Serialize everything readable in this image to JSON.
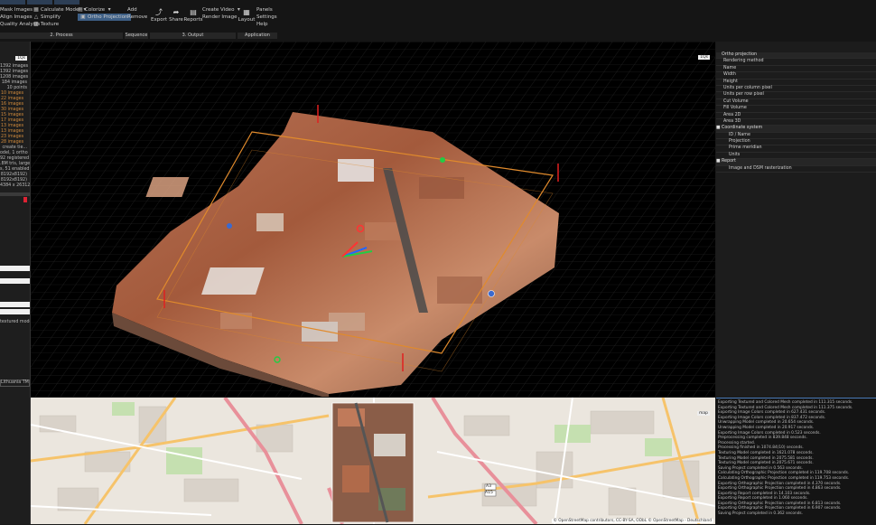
{
  "ribbon": {
    "tabs": [
      "",
      "",
      ""
    ],
    "process": {
      "label": "2. Process",
      "col1": [
        "Mask Images",
        "Align Images",
        "Quality Analysis"
      ],
      "col2": [
        "Calculate Model",
        "Simplify",
        "Texture"
      ],
      "col3": [
        "Colorize",
        "Ortho Projection"
      ]
    },
    "sequence": {
      "label": "Sequence",
      "items": [
        "Add",
        "Remove"
      ]
    },
    "output": {
      "label": "3. Output",
      "big": [
        "Export",
        "Share",
        "Reports"
      ],
      "items": [
        "Create Video",
        "Render Image"
      ]
    },
    "application": {
      "label": "Application",
      "big": "Layout",
      "items": [
        "Panels",
        "Settings",
        "Help"
      ]
    }
  },
  "left_panel": {
    "badge": "1Qs",
    "stats": [
      "1392 images",
      "1392 images",
      "1208 images",
      "184 images",
      "10 points"
    ],
    "groups": [
      "10 images",
      "22 images",
      "16 images",
      "30 images",
      "15 images",
      "17 images",
      "13 images",
      "13 images",
      "23 images",
      "28 images"
    ],
    "info": [
      "create tie...",
      "odel, 1 ortho",
      "92 registered",
      ".8M tris, large",
      "s, 51 enabled",
      "8192x8192)",
      "8192x8192)",
      "4384 x 26312"
    ],
    "lower": [
      "textured mode",
      "Lithuania TM"
    ]
  },
  "viewport": {
    "badge": "1Qs"
  },
  "properties": {
    "title": "Ortho projection",
    "rows": [
      "Rendering method",
      "Name",
      "Width",
      "Height",
      "Units per column pixel",
      "Units per row pixel",
      "Cut Volume",
      "Fill Volume",
      "Area 2D",
      "Area 3D"
    ],
    "coord_title": "Coordinate system",
    "coord_rows": [
      "ID / Name",
      "Projection",
      "Prime meridian",
      "Units"
    ],
    "report_title": "Report",
    "report_rows": [
      "Image and DSM rasterization"
    ]
  },
  "map": {
    "badge": "map",
    "attribution": "© OpenStreetMap contributors, CC-BY-SA, ODbL  © OpenStreetMap - Deutschland",
    "labels": [
      "A3",
      "A15"
    ]
  },
  "log": [
    "Exporting Textured and Colored Mesh completed in 111.315 seconds.",
    "Exporting Textured and Colored Mesh completed in 111.375 seconds.",
    "Exporting Image Colors completed in 627.431 seconds.",
    "Exporting Image Colors completed in 837.472 seconds.",
    "Unwrapping Model completed in 20.654 seconds.",
    "Unwrapping Model completed in 20.917 seconds.",
    "Exporting Image Colors completed in 0.523 seconds.",
    "Preprocessing completed in 839.848 seconds.",
    "Processing started.",
    "Processing finished in 1074.84(10) seconds.",
    "Texturing Model completed in 1621.078 seconds.",
    "Texturing Model completed in 2075.581 seconds.",
    "Texturing Model completed in 2075.671 seconds.",
    "Saving Project completed in 0.563 seconds.",
    "Calculating Orthographic Projection completed in 119.708 seconds.",
    "Calculating Orthographic Projection completed in 119.753 seconds.",
    "Exporting Orthographic Projection completed in 4.370 seconds.",
    "Exporting Orthographic Projection completed in 4.863 seconds.",
    "Exporting Report completed in 14.103 seconds.",
    "Exporting Report completed in 1.060 seconds.",
    "Exporting Orthographic Projection completed in 6.813 seconds.",
    "Exporting Orthographic Projection completed in 6.907 seconds.",
    "Saving Project completed in 0.362 seconds."
  ]
}
